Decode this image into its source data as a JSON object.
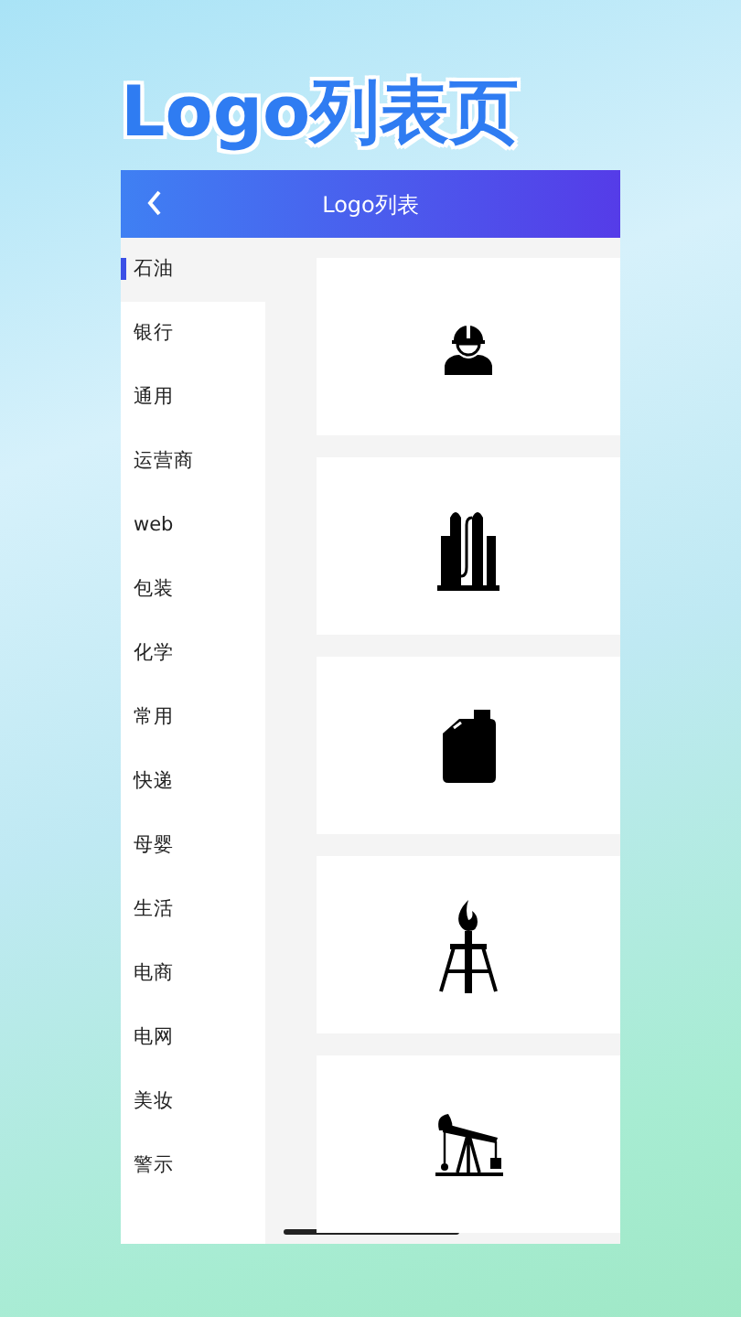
{
  "headline": "Logo列表页",
  "app_bar": {
    "title": "Logo列表"
  },
  "categories": [
    {
      "label": "石油",
      "selected": true
    },
    {
      "label": "银行",
      "selected": false
    },
    {
      "label": "通用",
      "selected": false
    },
    {
      "label": "运营商",
      "selected": false
    },
    {
      "label": "web",
      "selected": false
    },
    {
      "label": "包装",
      "selected": false
    },
    {
      "label": "化学",
      "selected": false
    },
    {
      "label": "常用",
      "selected": false
    },
    {
      "label": "快递",
      "selected": false
    },
    {
      "label": "母婴",
      "selected": false
    },
    {
      "label": "生活",
      "selected": false
    },
    {
      "label": "电商",
      "selected": false
    },
    {
      "label": "电网",
      "selected": false
    },
    {
      "label": "美妆",
      "selected": false
    },
    {
      "label": "警示",
      "selected": false
    }
  ],
  "logos": [
    {
      "kind": "worker"
    },
    {
      "kind": "refinery"
    },
    {
      "kind": "canister"
    },
    {
      "kind": "flare"
    },
    {
      "kind": "pumpjack"
    }
  ]
}
